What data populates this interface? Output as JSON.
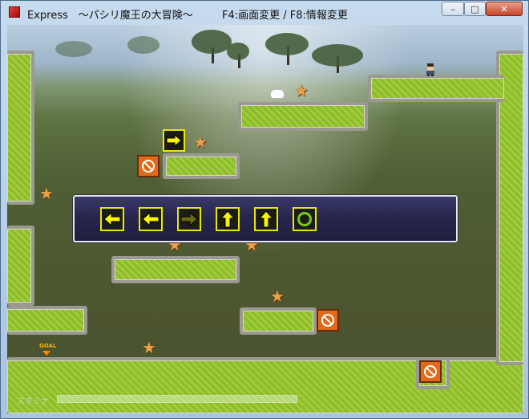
{
  "window": {
    "title": "Express　～パシリ魔王の大冒険～",
    "hint": "F4:画面変更 / F8:情報変更",
    "min_symbol": "–",
    "max_symbol": "□",
    "close_symbol": "✕"
  },
  "game": {
    "goal_label": "GOAL",
    "stamina_label": "スタミナ",
    "stamina_fraction": 1.0,
    "command_slots": [
      {
        "icon": "arrow-left-icon",
        "state": "active"
      },
      {
        "icon": "arrow-left-icon",
        "state": "active"
      },
      {
        "icon": "arrow-right-icon",
        "state": "dimmed"
      },
      {
        "icon": "arrow-up-icon",
        "state": "active"
      },
      {
        "icon": "arrow-up-icon",
        "state": "active"
      },
      {
        "icon": "ok-circle-icon",
        "state": "active"
      }
    ],
    "colors": {
      "arrow": "#f6f600",
      "arrow_dim": "#6a6a10",
      "circle": "#79c81a",
      "grass": "#9bc63a",
      "block": "#e06a18"
    }
  }
}
